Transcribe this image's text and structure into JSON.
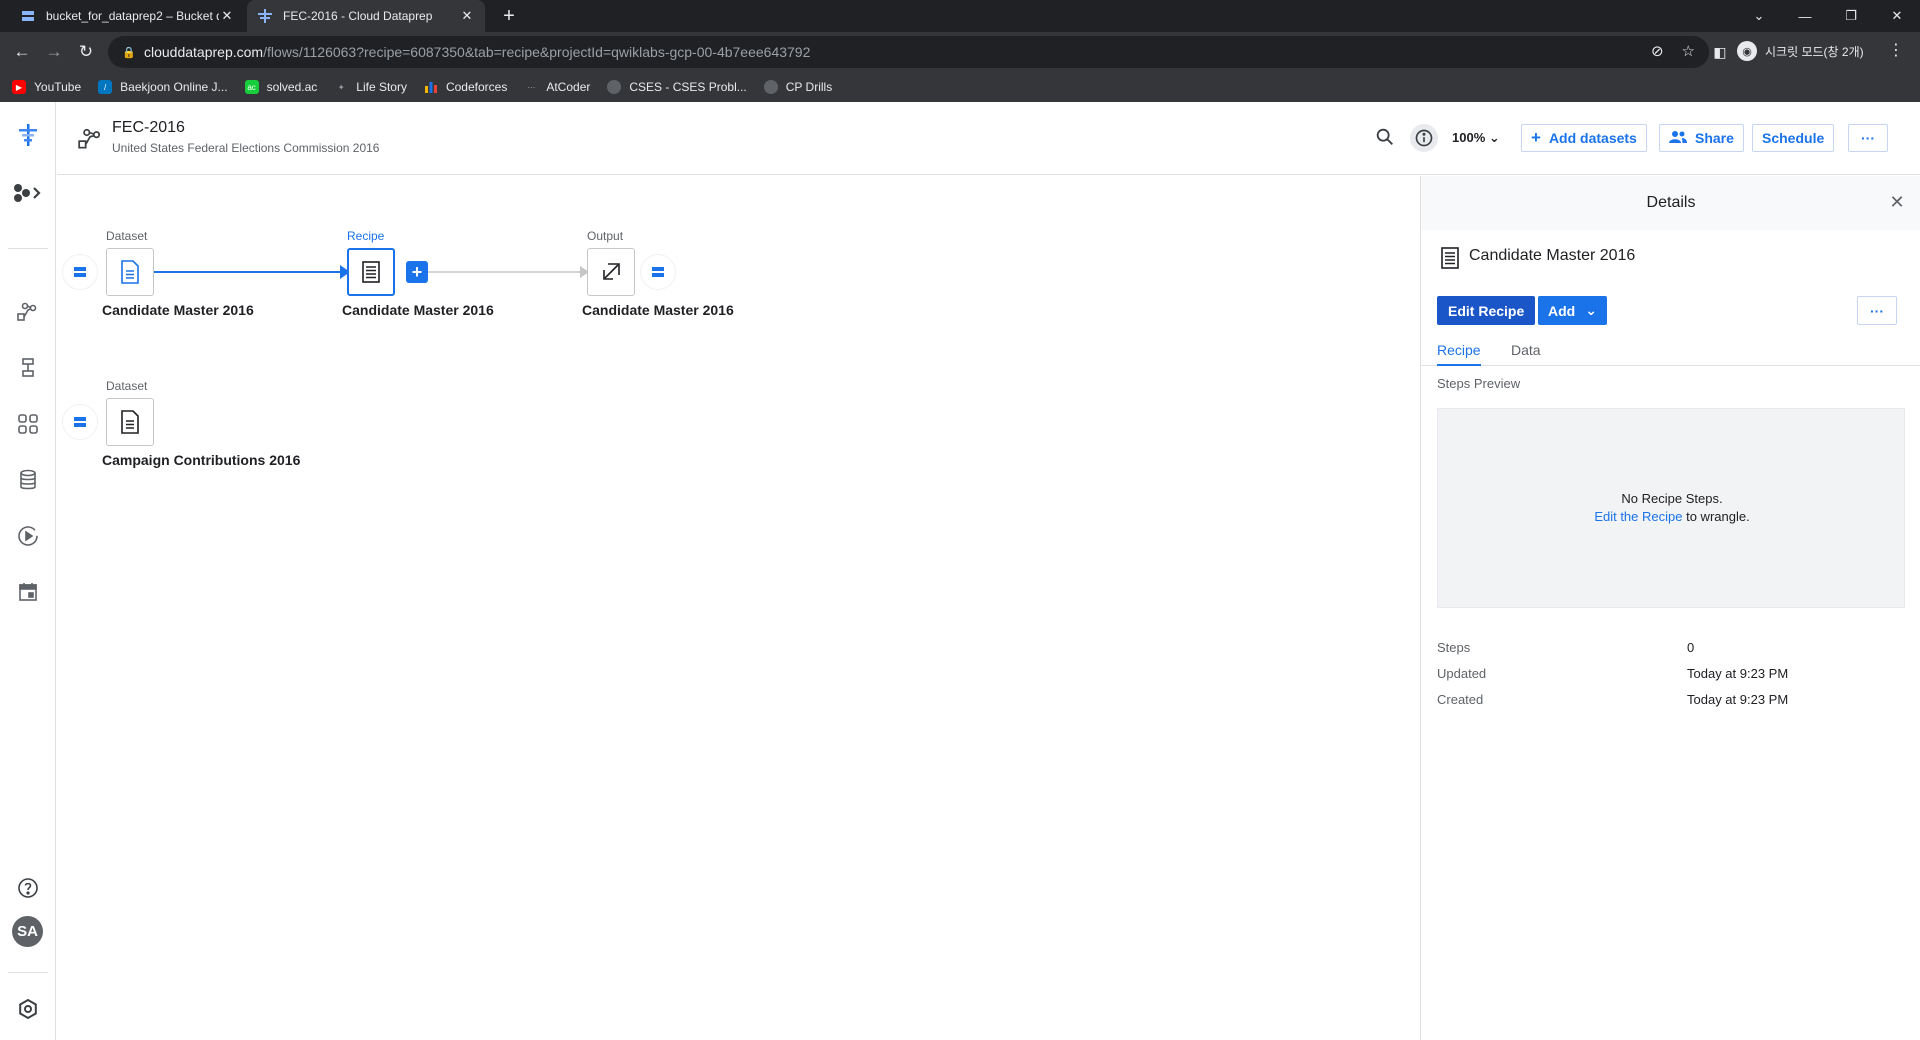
{
  "browser": {
    "tabs": [
      {
        "title": "bucket_for_dataprep2 – Bucket d",
        "icon": "bucket-icon",
        "active": false
      },
      {
        "title": "FEC-2016 - Cloud Dataprep",
        "icon": "dataprep-icon",
        "active": true
      }
    ],
    "url_host": "clouddataprep.com",
    "url_path": "/flows/1126063?recipe=6087350&tab=recipe&projectId=qwiklabs-gcp-00-4b7eee643792",
    "incognito_label": "시크릿 모드(창 2개)",
    "bookmarks": [
      {
        "label": "YouTube",
        "icon": "youtube-icon",
        "color": "#ff0000"
      },
      {
        "label": "Baekjoon Online J...",
        "icon": "baekjoon-icon",
        "color": "#0076c0"
      },
      {
        "label": "solved.ac",
        "icon": "solvedac-icon",
        "color": "#17ce3a"
      },
      {
        "label": "Life Story",
        "icon": "tree-icon",
        "color": "#9aa0a6"
      },
      {
        "label": "Codeforces",
        "icon": "codeforces-icon",
        "color": "#f4b400"
      },
      {
        "label": "AtCoder",
        "icon": "atcoder-icon",
        "color": "#5f6368"
      },
      {
        "label": "CSES - CSES Probl...",
        "icon": "globe-icon",
        "color": "#5f6368"
      },
      {
        "label": "CP Drills",
        "icon": "globe-icon",
        "color": "#5f6368"
      }
    ]
  },
  "app": {
    "flow_title": "FEC-2016",
    "flow_subtitle": "United States Federal Elections Commission 2016",
    "zoom": "100%",
    "add_datasets_label": "Add datasets",
    "share_label": "Share",
    "schedule_label": "Schedule",
    "more_label": "···",
    "user_initials": "SA",
    "accent": "#1a73e8"
  },
  "canvas": {
    "nodes": [
      {
        "type": "Dataset",
        "label": "Candidate Master 2016"
      },
      {
        "type": "Recipe",
        "label": "Candidate Master 2016"
      },
      {
        "type": "Output",
        "label": "Candidate Master 2016"
      },
      {
        "type": "Dataset",
        "label": "Campaign Contributions 2016"
      }
    ]
  },
  "details": {
    "title": "Details",
    "name": "Candidate Master 2016",
    "edit_recipe_label": "Edit Recipe",
    "add_label": "Add",
    "more_label": "···",
    "tabs": [
      "Recipe",
      "Data"
    ],
    "steps_preview_label": "Steps Preview",
    "no_steps_text": "No Recipe Steps.",
    "edit_link_text": "Edit the Recipe",
    "edit_suffix": " to wrangle.",
    "meta": [
      {
        "key": "Steps",
        "value": "0"
      },
      {
        "key": "Updated",
        "value": "Today at 9:23 PM"
      },
      {
        "key": "Created",
        "value": "Today at 9:23 PM"
      }
    ]
  }
}
